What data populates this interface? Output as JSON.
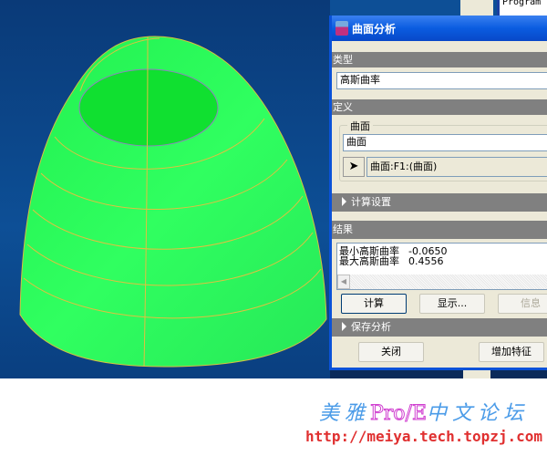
{
  "background_window": {
    "text": "Program (i"
  },
  "dialog": {
    "title": "曲面分析",
    "type_section": {
      "header": "类型",
      "value": "高斯曲率"
    },
    "definition_section": {
      "header": "定义",
      "group_label": "曲面",
      "surface_field": "曲面",
      "selection": "曲面:F1:(曲面)"
    },
    "compute_settings": "计算设置",
    "results_section": {
      "header": "结果",
      "rows": [
        {
          "label": "最小高斯曲率",
          "value": "-0.0650"
        },
        {
          "label": "最大高斯曲率",
          "value": "0.4556"
        }
      ]
    },
    "buttons": {
      "compute": "计算",
      "display": "显示...",
      "info": "信息"
    },
    "save_analysis": "保存分析",
    "footer": {
      "close": "关闭",
      "add_feature": "增加特征"
    }
  },
  "watermark": {
    "line1_a": "美雅",
    "line1_b": "Pro/E",
    "line1_c": "中文论坛",
    "url": "http://meiya.tech.topzj.com"
  }
}
